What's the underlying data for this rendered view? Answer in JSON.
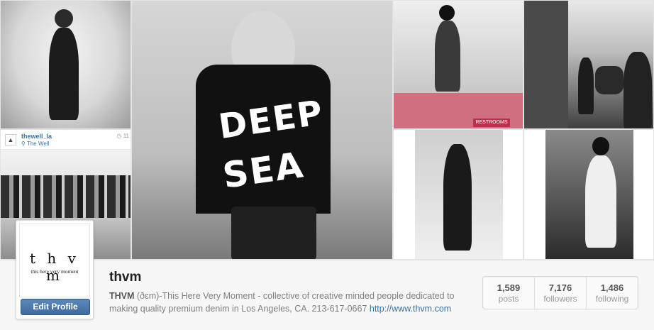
{
  "embedded_post": {
    "username": "thewell_la",
    "location": "The Well",
    "time": "11"
  },
  "truck_sign_text": "RESTROOMS",
  "big_photo_shirt": {
    "line1": "DEEP",
    "line2": "SEA"
  },
  "profile": {
    "logo_text": "t h v m",
    "logo_subtext": "this here very moment",
    "edit_button": "Edit Profile",
    "username": "thvm",
    "bio_name": "THVM",
    "bio_text": " (ðɛm)-This Here Very Moment - collective of creative minded people dedicated to making quality premium denim in Los Angeles, CA. 213-617-0667 ",
    "bio_link": "http://www.thvm.com"
  },
  "stats": [
    {
      "value": "1,589",
      "label": "posts"
    },
    {
      "value": "7,176",
      "label": "followers"
    },
    {
      "value": "1,486",
      "label": "following"
    }
  ],
  "colors": {
    "link_blue": "#3f729b",
    "button_blue": "#4a77a8",
    "truck_pink": "#cf6f80"
  }
}
